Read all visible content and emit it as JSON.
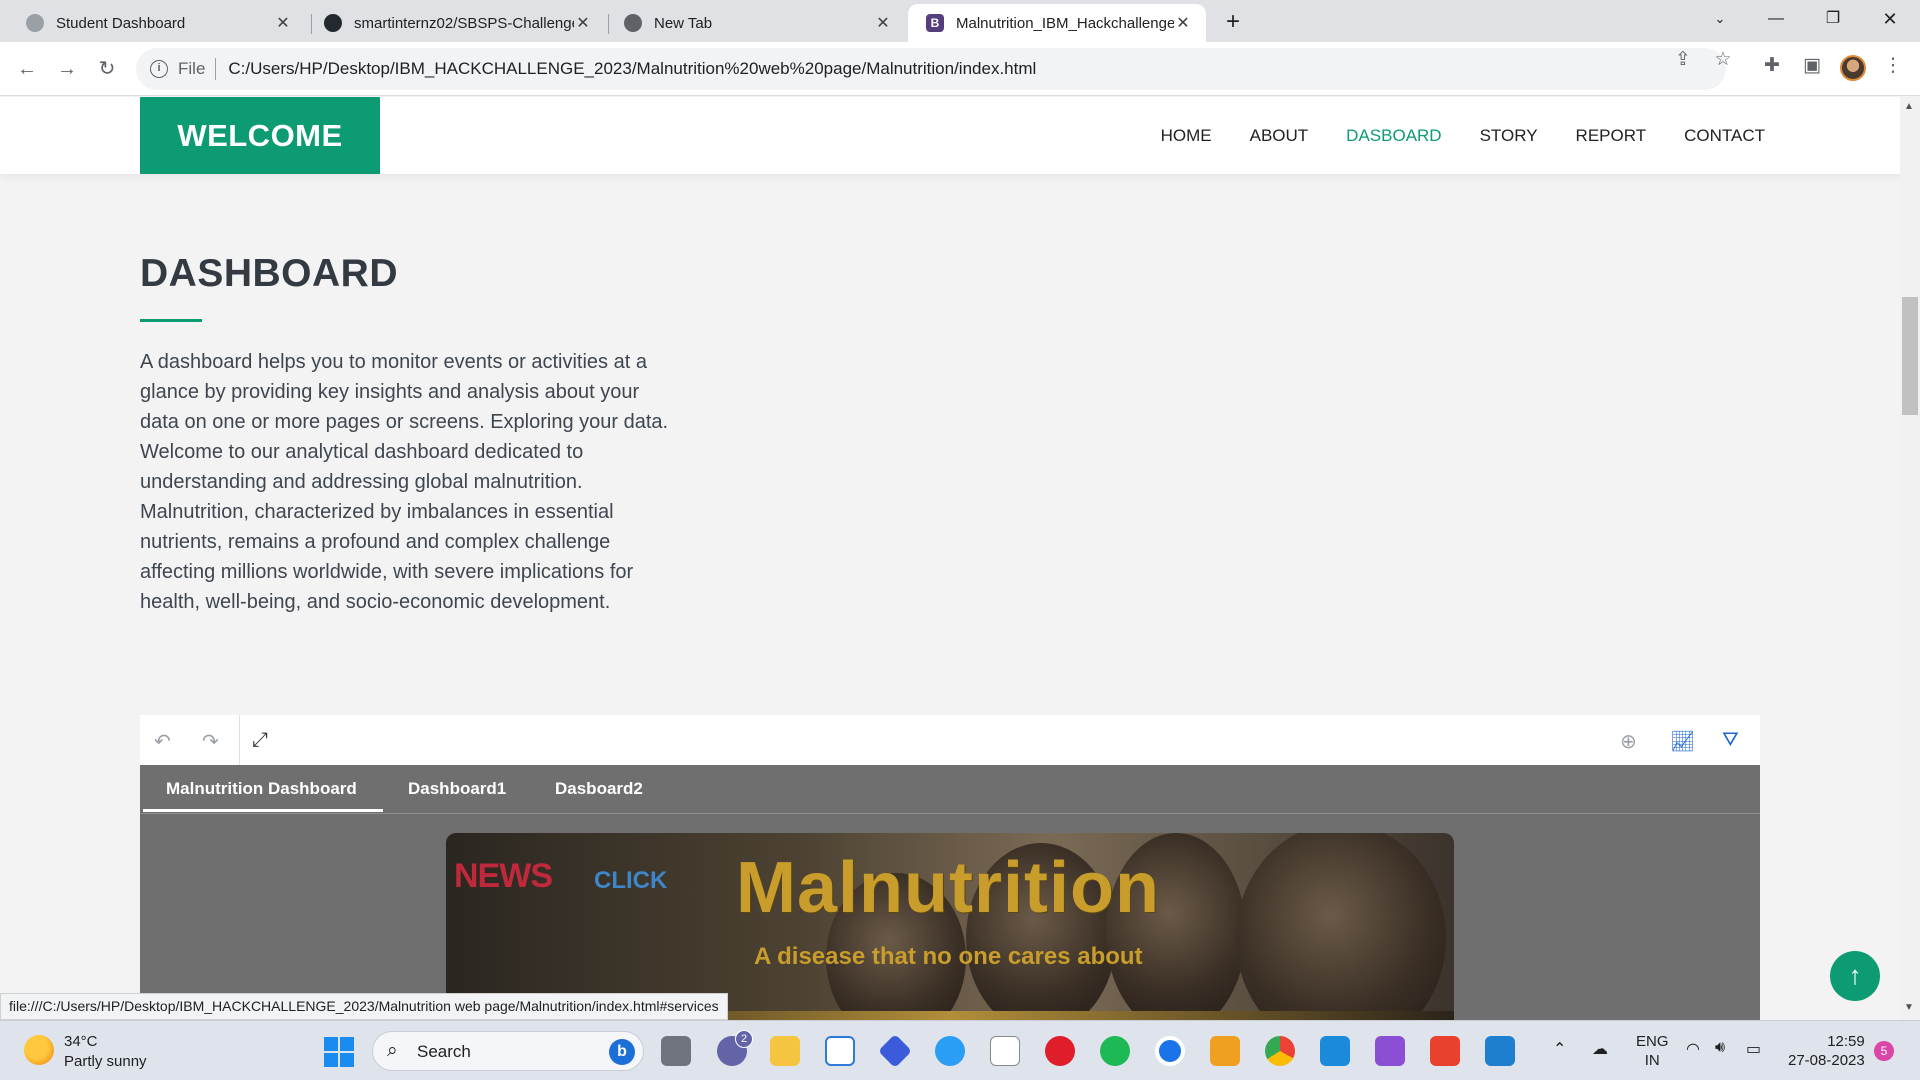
{
  "browser": {
    "tabs": [
      {
        "title": "Student Dashboard",
        "active": false
      },
      {
        "title": "smartinternz02/SBSPS-Challenge",
        "active": false
      },
      {
        "title": "New Tab",
        "active": false
      },
      {
        "title": "Malnutrition_IBM_Hackchallenge",
        "active": true
      }
    ],
    "favicon_letter": "B",
    "new_tab": "+",
    "address": {
      "scheme_label": "File",
      "url": "C:/Users/HP/Desktop/IBM_HACKCHALLENGE_2023/Malnutrition%20web%20page/Malnutrition/index.html"
    }
  },
  "site": {
    "logo": "WELCOME",
    "nav": [
      "HOME",
      "ABOUT",
      "DASBOARD",
      "STORY",
      "REPORT",
      "CONTACT"
    ],
    "active_nav": "DASBOARD",
    "section_title": "DASHBOARD",
    "description": "A dashboard helps you to monitor events or activities at a glance by providing key insights and analysis about your data on one or more pages or screens. Exploring your data.\nWelcome to our analytical dashboard dedicated to understanding and addressing global malnutrition. Malnutrition, characterized by imbalances in essential nutrients, remains a profound and complex challenge affecting millions worldwide, with severe implications for health, well-being, and socio-economic development."
  },
  "embed": {
    "tabs": [
      "Malnutrition Dashboard",
      "Dashboard1",
      "Dasboard2"
    ],
    "active_tab": "Malnutrition Dashboard",
    "banner": {
      "brand_news": "NEWS",
      "brand_click": "CLICK",
      "title": "Malnutrition",
      "subtitle": "A disease that no one cares about"
    }
  },
  "status_bar_url": "file:///C:/Users/HP/Desktop/IBM_HACKCHALLENGE_2023/Malnutrition web page/Malnutrition/index.html#services",
  "taskbar": {
    "weather": {
      "temp": "34°C",
      "desc": "Partly sunny"
    },
    "search_placeholder": "Search",
    "teams_badge": "2",
    "language": {
      "line1": "ENG",
      "line2": "IN"
    },
    "clock": {
      "time": "12:59",
      "date": "27-08-2023"
    },
    "notifications": "5"
  },
  "colors": {
    "accent": "#0c9b72",
    "dashboard_tabs_bg": "#6f6f6f",
    "banner_gold": "#c99d2b"
  }
}
